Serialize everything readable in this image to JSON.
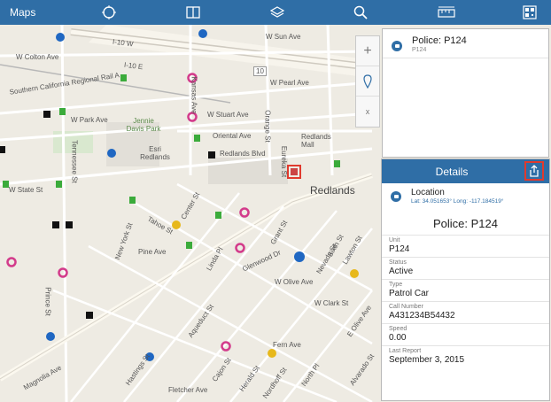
{
  "toolbar": {
    "title": "Maps",
    "icons": [
      "locate-icon",
      "basemap-split-icon",
      "layers-icon",
      "search-icon",
      "measure-icon",
      "qr-grid-icon"
    ]
  },
  "map": {
    "labels": [
      "W Sun Ave",
      "W Colton Ave",
      "Southern California Regional Rail A",
      "W Park Ave",
      "W Pearl Ave",
      "W Stuart Ave",
      "Jennie Davis Park",
      "Oriental Ave",
      "Esri Redlands",
      "Redlands Blvd",
      "Redlands Mall",
      "Redlands",
      "W State St",
      "Tennessee St",
      "New York St",
      "Pine Ave",
      "W Olive Ave",
      "W Clark St",
      "Prince St",
      "Magnolia Ave",
      "Fletcher Ave",
      "Cajon St",
      "Herald St",
      "Fern Ave",
      "North Pl",
      "Alvarado St",
      "Kansas Ave",
      "Orange St",
      "Grant St",
      "Linda Pl",
      "Glenwood Dr",
      "Eureka St",
      "Center St",
      "Nevada St",
      "Lawton St",
      "Nordhoff St",
      "Aqueduct St",
      "Tahoe St",
      "Sixth St",
      "Hastings St",
      "E Olive Ave",
      "I-10 W",
      "I-10 E",
      "10"
    ]
  },
  "zoom": {
    "in": "+",
    "out": "x"
  },
  "popup": {
    "title": "Police: P124",
    "subtitle": "P124"
  },
  "details": {
    "header": "Details",
    "location_label": "Location",
    "location_coords": "Lat: 34.051653° Long: -117.184519°",
    "title": "Police: P124",
    "fields": [
      {
        "label": "Unit",
        "value": "P124"
      },
      {
        "label": "Status",
        "value": "Active"
      },
      {
        "label": "Type",
        "value": "Patrol Car"
      },
      {
        "label": "Call Number",
        "value": "A431234B54432"
      },
      {
        "label": "Speed",
        "value": "0.00"
      },
      {
        "label": "Last Report",
        "value": "September 3, 2015"
      }
    ]
  },
  "colors": {
    "accent": "#2f6ea6",
    "highlight": "#e03a2e"
  }
}
